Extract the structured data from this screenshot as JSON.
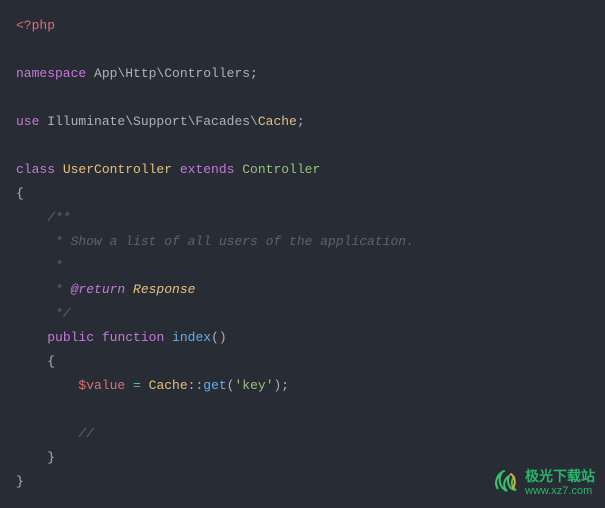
{
  "code": {
    "phpOpen": "<?php",
    "kw_namespace": "namespace",
    "ns_path": " App\\Http\\Controllers;",
    "kw_use": "use",
    "use_path_1": " Illuminate\\Support\\Facades\\",
    "use_path_2": "Cache",
    "use_semi": ";",
    "kw_class": "class",
    "class_name": " UserController ",
    "kw_extends": "extends",
    "base_class": " Controller",
    "brace_open": "{",
    "doc_l1": "    /**",
    "doc_l2": "     * Show a list of all users of the application.",
    "doc_l3": "     *",
    "doc_l4a": "     * ",
    "doc_return": "@return",
    "doc_type": " Response",
    "doc_l5": "     */",
    "indent4": "    ",
    "kw_public": "public",
    "sp": " ",
    "kw_function": "function",
    "fn_name": " index",
    "paren_pair": "()",
    "m_brace_open": "    {",
    "line_indent8": "        ",
    "var_value": "$value",
    "eq": " = ",
    "cache_cls": "Cache",
    "dbl_colon": "::",
    "get_fn": "get",
    "lp": "(",
    "key_str": "'key'",
    "rp_semi": ");",
    "slashslash": "//",
    "m_brace_close": "    }",
    "brace_close": "}"
  },
  "watermark": {
    "line1": "极光下载站",
    "line2": "www.xz7.com"
  }
}
